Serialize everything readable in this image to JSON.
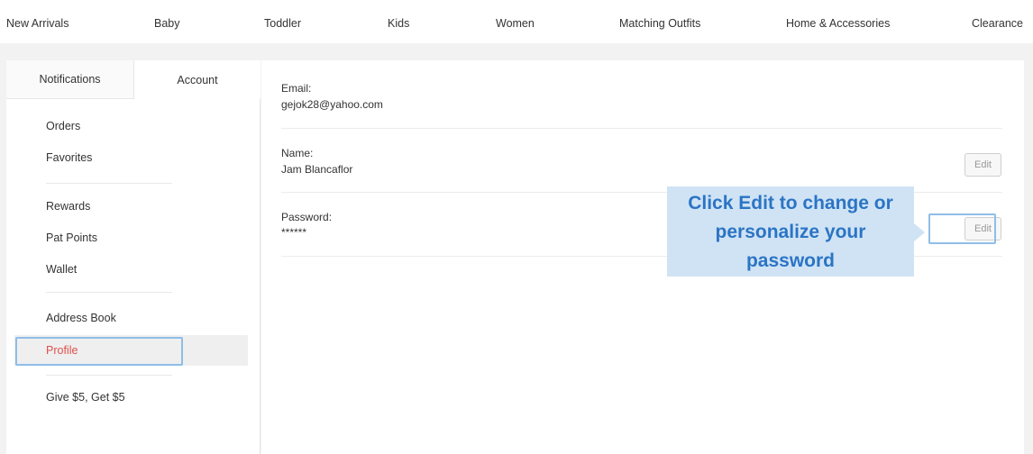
{
  "topnav": {
    "items": [
      "New Arrivals",
      "Baby",
      "Toddler",
      "Kids",
      "Women",
      "Matching Outfits",
      "Home & Accessories",
      "Clearance"
    ]
  },
  "sidebar": {
    "tabs": [
      "Notifications",
      "Account"
    ],
    "items": [
      "Orders",
      "Favorites",
      "Rewards",
      "Pat Points",
      "Wallet",
      "Address Book",
      "Profile",
      "Give $5, Get $5"
    ]
  },
  "profile": {
    "email_label": "Email:",
    "email_value": "gejok28@yahoo.com",
    "name_label": "Name:",
    "name_value": "Jam Blancaflor",
    "password_label": "Password:",
    "password_value": "******",
    "edit_label": "Edit"
  },
  "callout": {
    "lines": [
      "Click Edit to change or",
      "personalize your",
      "password"
    ]
  },
  "colors": {
    "accent_red": "#e0504c",
    "callout_bg": "#cfe3f5",
    "callout_text": "#2b74c4",
    "highlight_border": "#8fbde8"
  }
}
